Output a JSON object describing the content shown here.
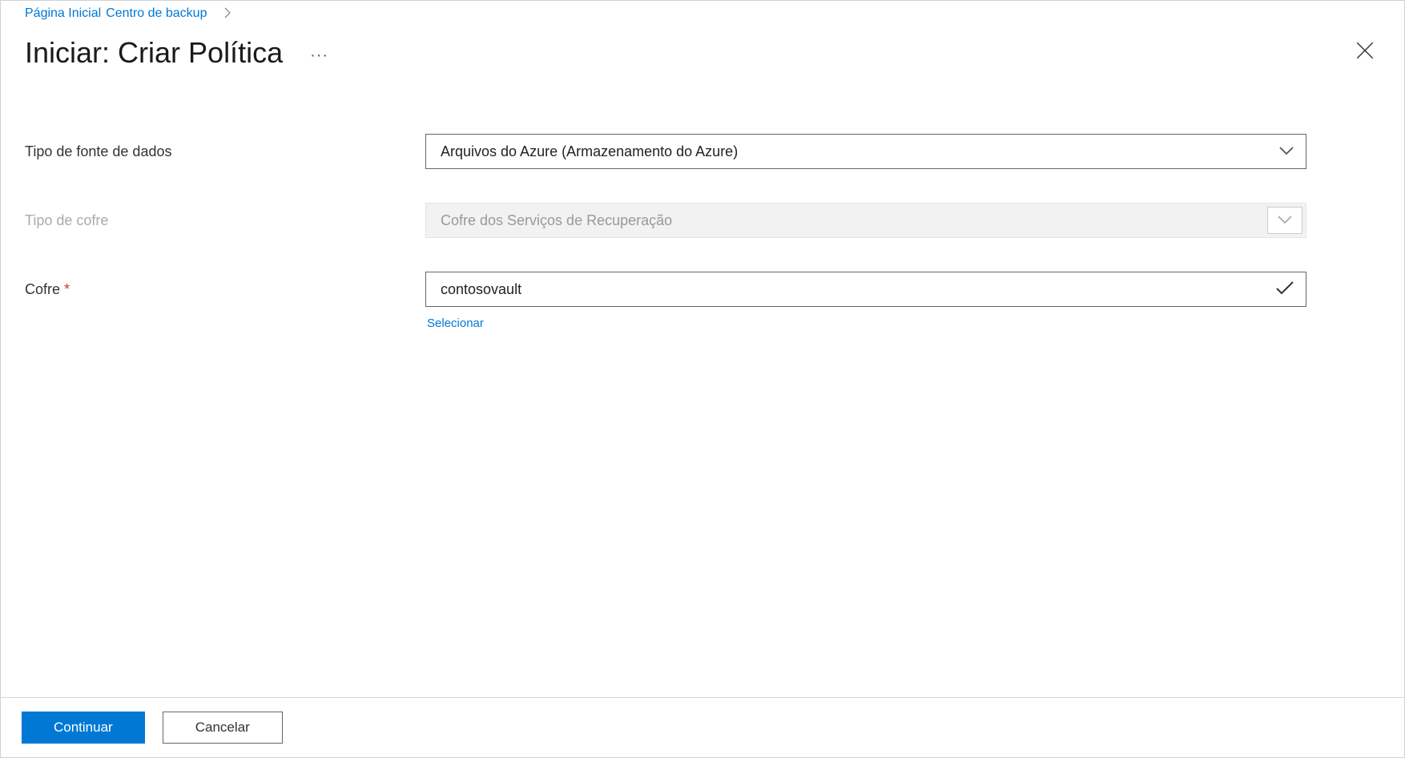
{
  "breadcrumb": {
    "home": "Página Inicial",
    "section": "Centro de backup"
  },
  "header": {
    "title": "Iniciar: Criar Política"
  },
  "form": {
    "datasource_type": {
      "label": "Tipo de fonte de dados",
      "value": "Arquivos do Azure (Armazenamento do Azure)"
    },
    "vault_type": {
      "label": "Tipo de cofre",
      "value": "Cofre dos Serviços de Recuperação"
    },
    "vault": {
      "label": "Cofre",
      "value": "contosovault",
      "helper_link": "Selecionar"
    }
  },
  "footer": {
    "continue_label": "Continuar",
    "cancel_label": "Cancelar"
  }
}
